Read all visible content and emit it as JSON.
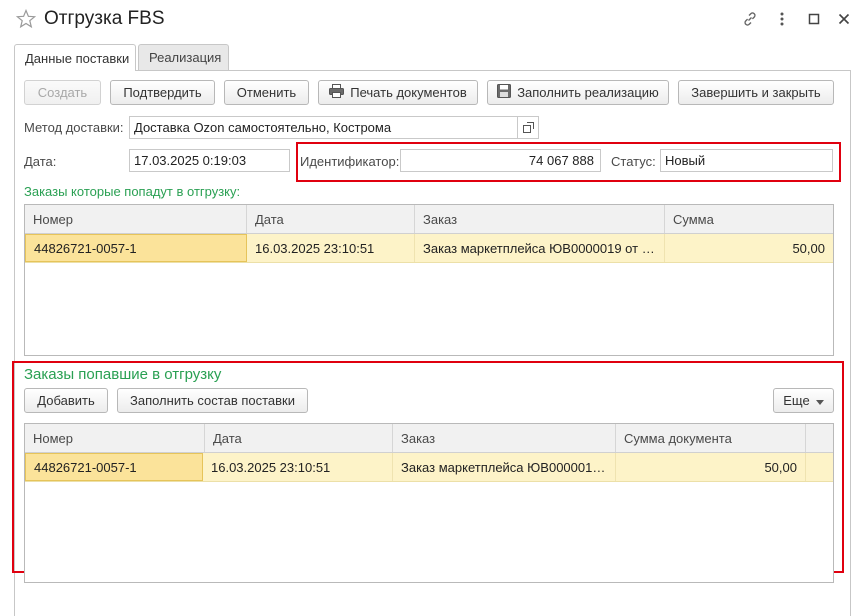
{
  "window": {
    "title": "Отгрузка FBS",
    "icons": [
      "star-icon",
      "link-icon",
      "more-icon",
      "maximize-icon",
      "close-icon"
    ]
  },
  "tabs": [
    {
      "label": "Данные поставки",
      "active": true
    },
    {
      "label": "Реализация",
      "active": false
    }
  ],
  "toolbar": {
    "create_label": "Создать",
    "confirm_label": "Подтвердить",
    "cancel_label": "Отменить",
    "print_label": "Печать документов",
    "fill_sale_label": "Заполнить реализацию",
    "finish_label": "Завершить и закрыть"
  },
  "form": {
    "delivery_method_label": "Метод доставки:",
    "delivery_method_value": "Доставка Ozon самостоятельно, Кострома",
    "date_label": "Дата:",
    "date_value": "17.03.2025  0:19:03",
    "identifier_label": "Идентификатор:",
    "identifier_value": "74 067 888",
    "status_label": "Статус:",
    "status_value": "Новый"
  },
  "orders_to_ship": {
    "caption": "Заказы которые попадут в отгрузку:",
    "columns": [
      "Номер",
      "Дата",
      "Заказ",
      "Сумма"
    ],
    "rows": [
      {
        "number": "44826721-0057-1",
        "date": "16.03.2025 23:10:51",
        "order": "Заказ маркетплейса ЮВ0000019 от …",
        "sum": "50,00"
      }
    ]
  },
  "orders_shipped": {
    "caption": "Заказы попавшие в отгрузку",
    "add_label": "Добавить",
    "fill_label": "Заполнить состав поставки",
    "more_label": "Еще",
    "columns": [
      "Номер",
      "Дата",
      "Заказ",
      "Сумма документа"
    ],
    "rows": [
      {
        "number": "44826721-0057-1",
        "date": "16.03.2025 23:10:51",
        "order": "Заказ маркетплейса ЮВ000001…",
        "sum": "50,00"
      }
    ]
  },
  "colors": {
    "highlight": "#e0000f",
    "caption_green": "#2aa053",
    "row_selected": "#fdf3c8"
  }
}
